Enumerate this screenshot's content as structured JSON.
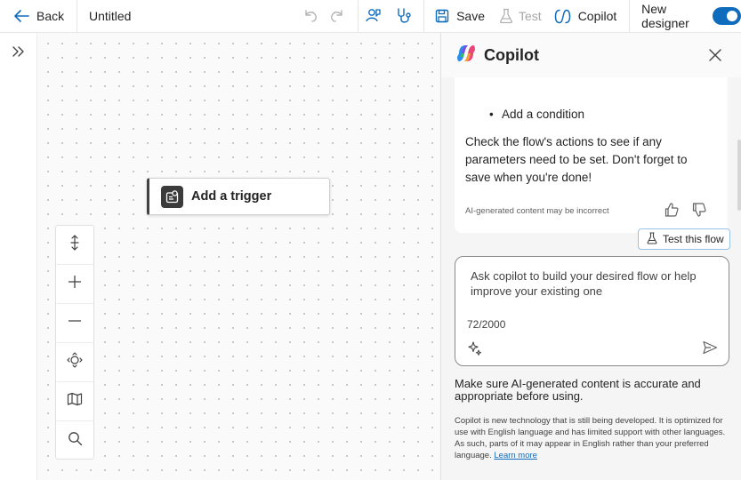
{
  "topbar": {
    "back_label": "Back",
    "title": "Untitled",
    "save_label": "Save",
    "test_label": "Test",
    "copilot_label": "Copilot",
    "new_designer_label": "New designer",
    "new_designer_on": true,
    "accent_color": "#0f6cbd"
  },
  "canvas": {
    "trigger_label": "Add a trigger",
    "zoom_controls": [
      "fit-vertical-icon",
      "zoom-in-icon",
      "zoom-out-icon",
      "fit-view-icon",
      "minimap-icon",
      "search-icon"
    ]
  },
  "copilot": {
    "title": "Copilot",
    "message": {
      "bullet": "Add a condition",
      "text": "Check the flow's actions to see if any parameters need to be set. Don't forget to save when you're done!",
      "disclaimer": "AI-generated content may be incorrect"
    },
    "test_flow_label": "Test this flow",
    "input": {
      "placeholder": "Ask copilot to build your desired flow or help improve your existing one",
      "counter": "72/2000"
    },
    "notice": "Make sure AI-generated content is accurate and appropriate before using.",
    "fine_print": "Copilot is new technology that is still being developed. It is optimized for use with English language and has limited support with other languages. As such, parts of it may appear in English rather than your preferred language.",
    "learn_more": "Learn more"
  }
}
